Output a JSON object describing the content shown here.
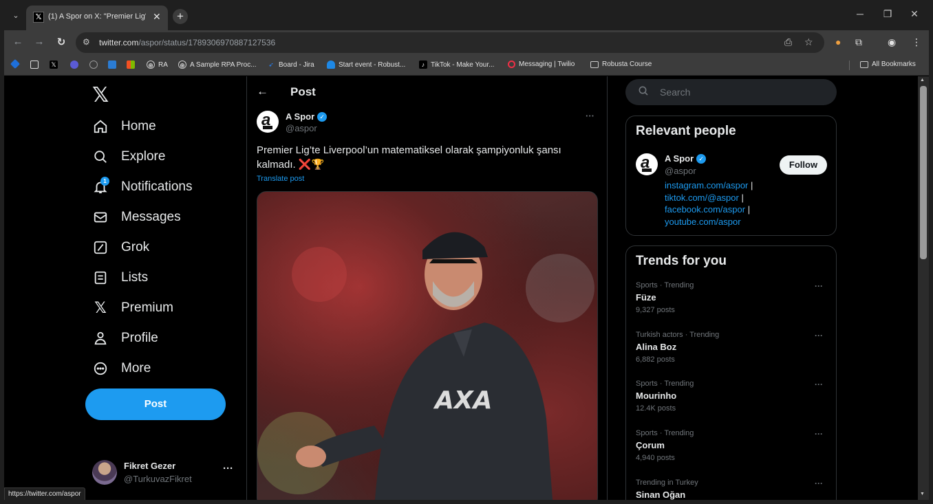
{
  "browser": {
    "tab_title": "(1) A Spor on X: \"Premier Lig'te",
    "url_domain": "twitter.com",
    "url_path": "/aspor/status/1789306970887127536",
    "status_url": "https://twitter.com/aspor"
  },
  "bookmarks": {
    "items": [
      {
        "label": "RA",
        "icon": "globe-icon"
      },
      {
        "label": "A Sample RPA Proc...",
        "icon": "globe-icon"
      },
      {
        "label": "Board - Jira",
        "icon": "jira-icon"
      },
      {
        "label": "Start event - Robust...",
        "icon": "bpmn-icon"
      },
      {
        "label": "TikTok - Make Your...",
        "icon": "tiktok-icon"
      },
      {
        "label": "Messaging | Twilio",
        "icon": "twilio-icon"
      },
      {
        "label": "Robusta Course",
        "icon": "folder-icon"
      }
    ],
    "all_bookmarks": "All Bookmarks"
  },
  "nav": {
    "items": [
      {
        "label": "Home",
        "icon": "home-icon"
      },
      {
        "label": "Explore",
        "icon": "search-icon"
      },
      {
        "label": "Notifications",
        "icon": "bell-icon",
        "badge": "1"
      },
      {
        "label": "Messages",
        "icon": "envelope-icon"
      },
      {
        "label": "Grok",
        "icon": "grok-icon"
      },
      {
        "label": "Lists",
        "icon": "list-icon"
      },
      {
        "label": "Premium",
        "icon": "x-icon"
      },
      {
        "label": "Profile",
        "icon": "person-icon"
      },
      {
        "label": "More",
        "icon": "more-circle-icon"
      }
    ],
    "post_button": "Post"
  },
  "account": {
    "name": "Fikret Gezer",
    "handle": "@TurkuvazFikret"
  },
  "main": {
    "title": "Post",
    "author_name": "A Spor",
    "author_handle": "@aspor",
    "text": "Premier Lig’te Liverpool’un matematiksel olarak şampiyonluk şansı kalmadı. ❌🏆",
    "translate": "Translate post"
  },
  "right": {
    "search_placeholder": "Search",
    "relevant_title": "Relevant people",
    "person_name": "A Spor",
    "person_handle": "@aspor",
    "follow_label": "Follow",
    "bio_links": [
      "instagram.com/aspor",
      "tiktok.com/@aspor",
      "facebook.com/aspor",
      "youtube.com/aspor"
    ],
    "trends_title": "Trends for you",
    "trends": [
      {
        "meta": "Sports · Trending",
        "name": "Füze",
        "count": "9,327 posts"
      },
      {
        "meta": "Turkish actors · Trending",
        "name": "Alina Boz",
        "count": "6,882 posts"
      },
      {
        "meta": "Sports · Trending",
        "name": "Mourinho",
        "count": "12.4K posts"
      },
      {
        "meta": "Sports · Trending",
        "name": "Çorum",
        "count": "4,940 posts"
      },
      {
        "meta": "Trending in Turkey",
        "name": "Sinan Oğan",
        "count": ""
      }
    ]
  },
  "colors": {
    "accent": "#1d9bf0",
    "background": "#000000",
    "text": "#e7e9ea",
    "muted": "#71767b"
  }
}
